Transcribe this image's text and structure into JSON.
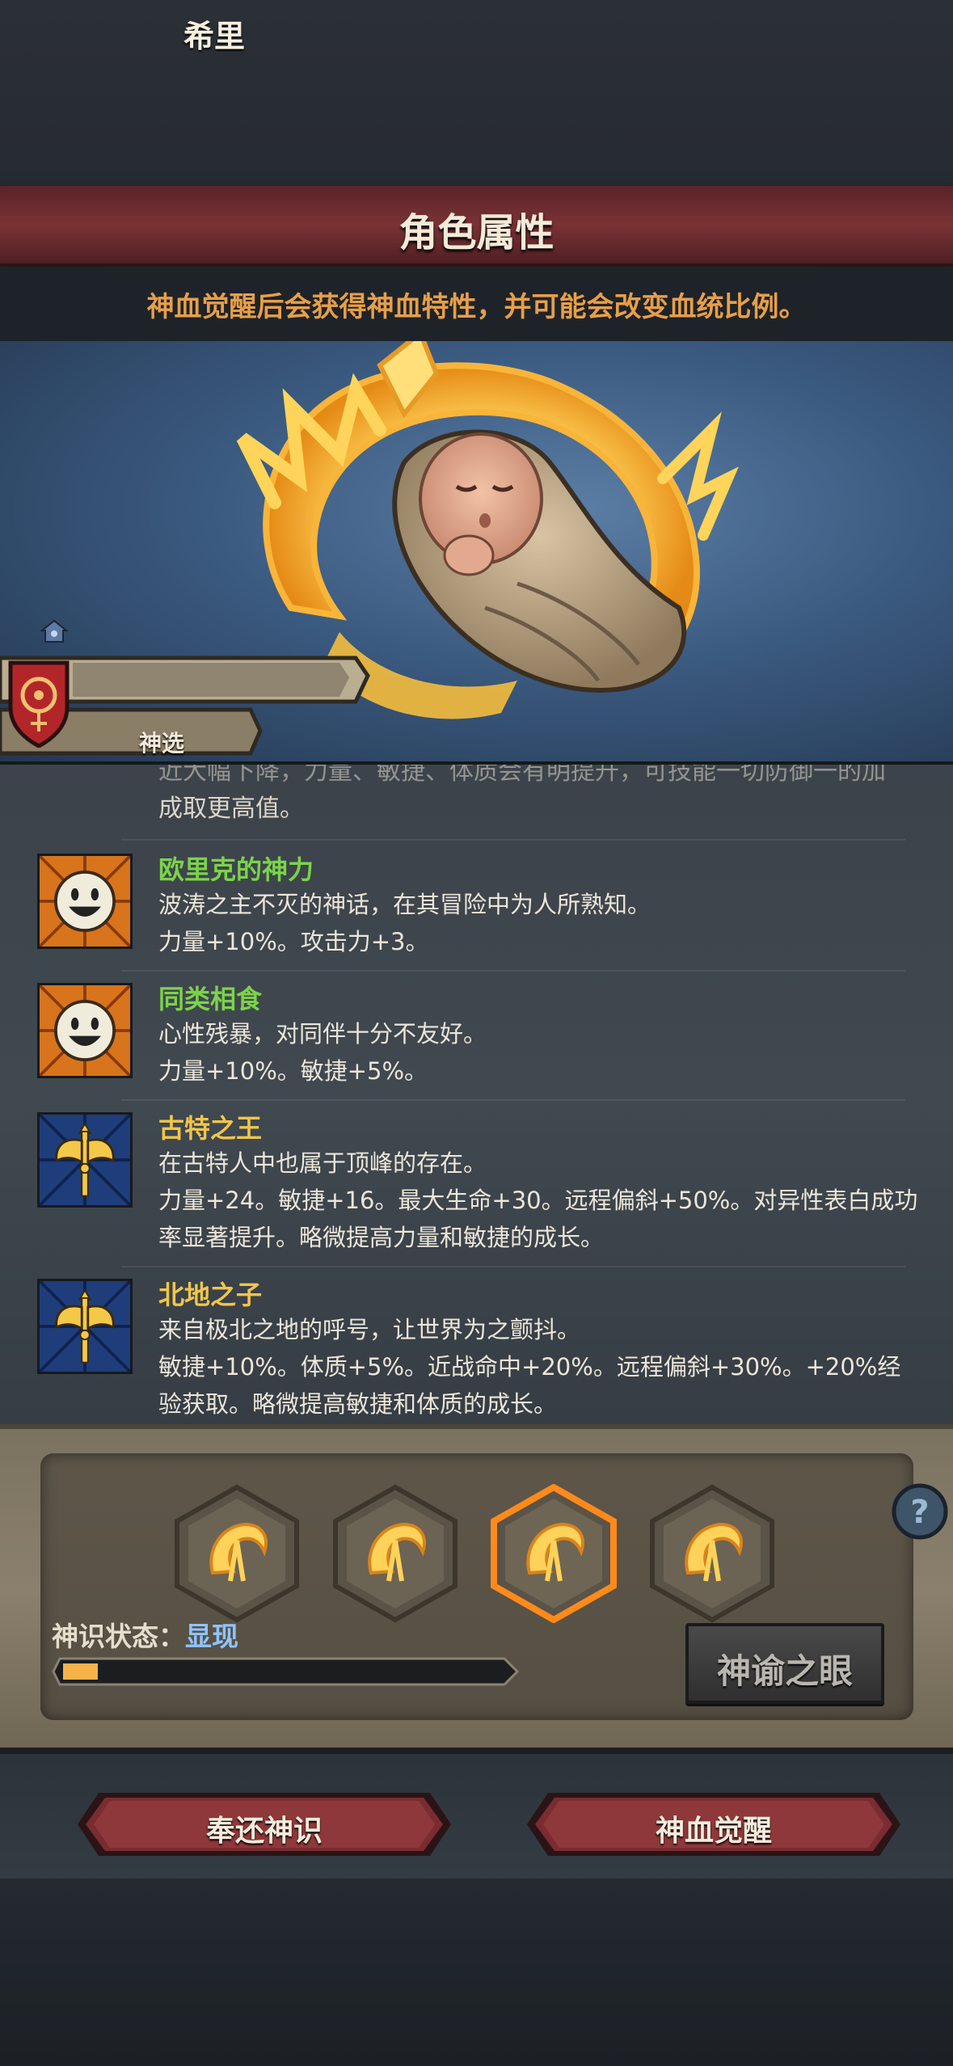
{
  "header": {
    "title": "角色属性",
    "notice": "神血觉醒后会获得神血特性，并可能会改变血统比例。"
  },
  "character": {
    "name": "希里",
    "subtitle": "神选"
  },
  "traits": {
    "partial_line_top": "近大幅下降，力量、敏捷、体质会有明提升，可技能一切防御一的加",
    "partial_line_bottom": "成取更高值。",
    "items": [
      {
        "name": "欧里克的神力",
        "name_color": "#7bd34a",
        "icon": "smiley-face-icon",
        "desc": "波涛之主不灭的神话，在其冒险中为人所熟知。",
        "effect": "力量+10%。攻击力+3。"
      },
      {
        "name": "同类相食",
        "name_color": "#7bd34a",
        "icon": "smiley-face-icon",
        "desc": "心性残暴，对同伴十分不友好。",
        "effect": "力量+10%。敏捷+5%。"
      },
      {
        "name": "古特之王",
        "name_color": "#f0c64a",
        "icon": "golden-axe-icon",
        "desc": "在古特人中也属于顶峰的存在。",
        "effect": "力量+24。敏捷+16。最大生命+30。远程偏斜+50%。对异性表白成功率显著提升。略微提高力量和敏捷的成长。"
      },
      {
        "name": "北地之子",
        "name_color": "#f0c64a",
        "icon": "golden-axe-icon",
        "desc": "来自极北之地的呼号，让世界为之颤抖。",
        "effect": "敏捷+10%。体质+5%。近战命中+20%。远程偏斜+30%。+20%经验获取。略微提高敏捷和体质的成长。"
      }
    ]
  },
  "divine": {
    "slots": 4,
    "selected_slot": 3,
    "status_label": "神识状态：",
    "status_value": "显现",
    "progress": 0.08,
    "eye_button": "神谕之眼"
  },
  "actions": {
    "return_button": "奉还神识",
    "awaken_button": "神血觉醒"
  },
  "colors": {
    "accent_orange": "#f2a64a",
    "status_blue": "#8fc4ff",
    "title_red": "#7a3236"
  }
}
